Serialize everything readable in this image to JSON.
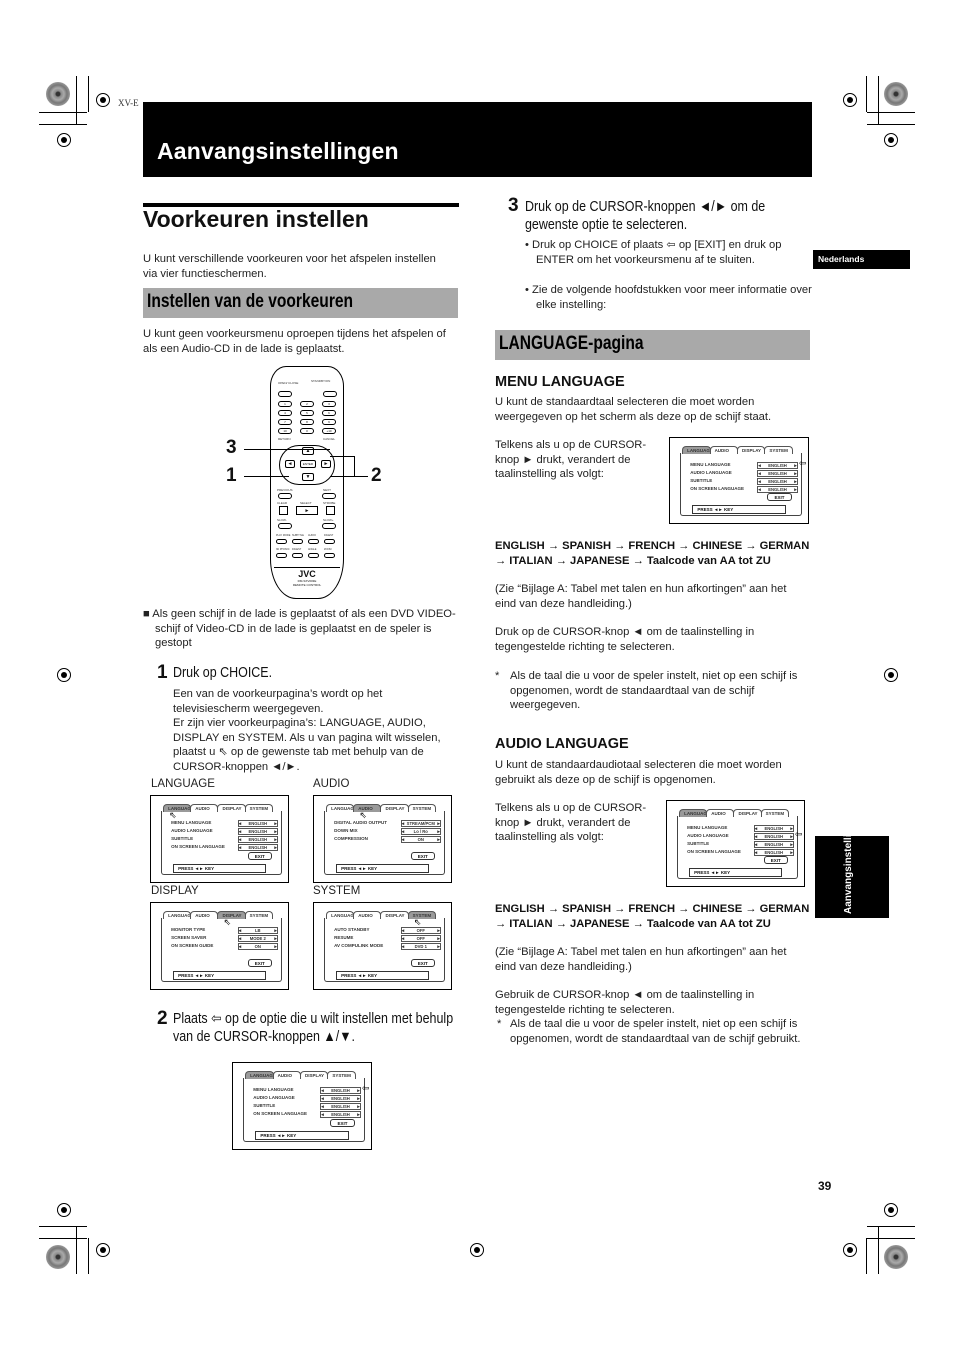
{
  "header": {
    "model_code": "XV-E",
    "title": "Aanvangsinstellingen"
  },
  "language_tag": "Nederlands",
  "side_tab": "Aanvangsinstellingen",
  "page_number": "39",
  "left": {
    "section_title": "Voorkeuren instellen",
    "intro": "U kunt verschillende voorkeuren voor het afspelen instellen via vier functieschermen.",
    "subsection_title": "Instellen van de voorkeuren",
    "subsection_intro": "U kunt geen voorkeursmenu oproepen tijdens het afspelen of als een Audio-CD in de lade is geplaatst.",
    "remote": {
      "brand": "JVC",
      "model": "RM-SXV003E",
      "caption": "REMOTE CONTROL",
      "labels": {
        "open_close": "OPEN/ CLOSE",
        "standby_on": "STANDBY/ON",
        "return": "RETURN",
        "cancel": "CANCEL",
        "enter": "ENTER",
        "previous": "PREVIOUS",
        "next": "NEXT",
        "clear": "CLEAR",
        "select": "SELECT",
        "strobe": "STROBE",
        "slow_minus": "SLOW-",
        "slow_plus": "SLOW+",
        "row1": [
          "PLAY MODE",
          "SUBTITLE",
          "AUDIO",
          "DIGEST"
        ],
        "row2": [
          "3D PHONIC",
          "DIGEST",
          "ANGLE",
          "ZOOM"
        ]
      },
      "digits": [
        "1",
        "2",
        "3",
        "4",
        "5",
        "6",
        "7",
        "8",
        "9",
        "10",
        "0",
        "+10"
      ],
      "callouts": {
        "one": "1",
        "two": "2",
        "three": "3"
      }
    },
    "condition": "Als geen schijf in de lade is geplaatst of als een DVD VIDEO-schijf of Video-CD in de lade is geplaatst en de speler is gestopt",
    "step1": {
      "num": "1",
      "title": "Druk op CHOICE.",
      "body": "Een van de voorkeurpagina’s wordt op het televisiescherm weergegeven.",
      "body2a": "Er zijn vier voorkeurpagina’s: LANGUAGE, AUDIO, DISPLAY en SYSTEM. Als u van pagina wilt wisselen, plaatst u",
      "body2b": "op de gewenste tab met behulp van de CURSOR-knoppen ◄/►."
    },
    "screens": [
      {
        "caption": "LANGUAGE",
        "active_tab": 0,
        "rows": [
          {
            "label": "MENU LANGUAGE",
            "value": "ENGLISH"
          },
          {
            "label": "AUDIO LANGUAGE",
            "value": "ENGLISH"
          },
          {
            "label": "SUBTITLE",
            "value": "ENGLISH"
          },
          {
            "label": "ON SCREEN LANGUAGE",
            "value": "ENGLISH"
          }
        ]
      },
      {
        "caption": "AUDIO",
        "active_tab": 1,
        "rows": [
          {
            "label": "DIGITAL AUDIO OUTPUT",
            "value": "STREAM/PCM"
          },
          {
            "label": "DOWN MIX",
            "value": "Lo / Ro"
          },
          {
            "label": "COMPRESSION",
            "value": "ON"
          }
        ]
      },
      {
        "caption": "DISPLAY",
        "active_tab": 2,
        "rows": [
          {
            "label": "MONITOR TYPE",
            "value": "LB"
          },
          {
            "label": "SCREEN SAVER",
            "value": "MODE 2"
          },
          {
            "label": "ON SCREEN GUIDE",
            "value": "ON"
          }
        ]
      },
      {
        "caption": "SYSTEM",
        "active_tab": 3,
        "rows": [
          {
            "label": "AUTO STANDBY",
            "value": "OFF"
          },
          {
            "label": "RESUME",
            "value": "OFF"
          },
          {
            "label": "AV COMPULINK MODE",
            "value": "DVD 1"
          }
        ]
      }
    ],
    "step2": {
      "num": "2",
      "title_a": "Plaats",
      "title_b": "op de optie die u wilt instellen met behulp van de CURSOR-knoppen ▲/▼."
    }
  },
  "screen_common": {
    "tabs": [
      "LANGUAGE",
      "AUDIO",
      "DISPLAY",
      "SYSTEM"
    ],
    "exit": "EXIT",
    "press": "PRESS ◄► KEY"
  },
  "right": {
    "step3": {
      "num": "3",
      "title": "Druk op de CURSOR-knoppen ◄/► om de gewenste optie te selecteren.",
      "bullet1_a": "Druk op CHOICE of plaats",
      "bullet1_b": "op [EXIT] en druk op ENTER om het voorkeursmenu af te sluiten.",
      "bullet2": "Zie de volgende hoofdstukken voor meer informatie over elke instelling:"
    },
    "page_head": "LANGUAGE-pagina",
    "menu_language": {
      "title": "MENU LANGUAGE",
      "intro": "U kunt de standaardtaal selecteren die moet worden weergegeven op het scherm als deze op de schijf staat.",
      "cycle_text": "Telkens als u op de CURSOR-knop ► drukt, verandert de taalinstelling als volgt:",
      "sequence": "ENGLISH → SPANISH → FRENCH → CHINESE → GERMAN → ITALIAN → JAPANESE → Taalcode van AA tot ZU",
      "ref": "(Zie “Bijlage A: Tabel met talen en hun afkortingen” aan het eind van deze handleiding.)",
      "reverse": "Druk op de CURSOR-knop ◄ om de taalinstelling in tegengestelde richting te selecteren.",
      "note_star": "*",
      "note": "Als de taal die u voor de speler instelt, niet op een schijf is opgenomen, wordt de standaardtaal van de schijf weergegeven."
    },
    "audio_language": {
      "title": "AUDIO LANGUAGE",
      "intro": "U kunt de standaardaudiotaal selecteren die moet worden gebruikt als deze op de schijf is opgenomen.",
      "cycle_text": "Telkens als u op de CURSOR-knop ► drukt, verandert de taalinstelling als volgt:",
      "sequence": "ENGLISH → SPANISH → FRENCH → CHINESE → GERMAN → ITALIAN → JAPANESE → Taalcode van AA tot ZU",
      "ref": "(Zie “Bijlage A: Tabel met talen en hun afkortingen” aan het eind van deze handleiding.)",
      "reverse": "Gebruik de CURSOR-knop ◄ om de taalinstelling in tegengestelde richting te selecteren.",
      "note_star": "*",
      "note": "Als de taal die u voor de speler instelt, niet op een schijf is opgenomen, wordt de standaardtaal van de schijf gebruikt."
    },
    "lang_screen_rows": [
      {
        "label": "MENU LANGUAGE",
        "value": "ENGLISH"
      },
      {
        "label": "AUDIO LANGUAGE",
        "value": "ENGLISH"
      },
      {
        "label": "SUBTITLE",
        "value": "ENGLISH"
      },
      {
        "label": "ON SCREEN LANGUAGE",
        "value": "ENGLISH"
      }
    ]
  }
}
